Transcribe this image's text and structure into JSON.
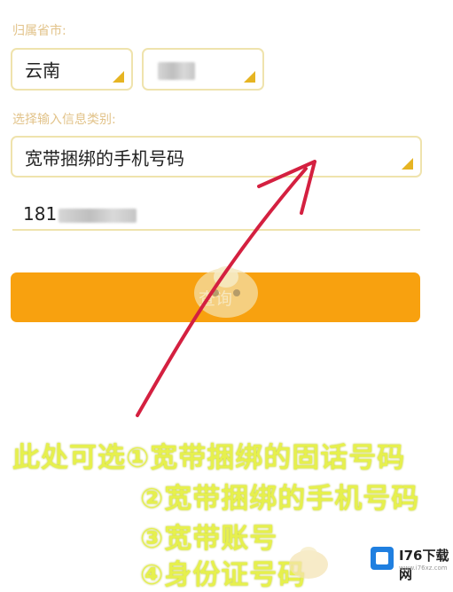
{
  "form": {
    "province_city_label": "归属省市:",
    "province_value": "云南",
    "info_type_label": "选择输入信息类别:",
    "info_type_value": "宽带捆绑的手机号码",
    "phone_visible_prefix": "181",
    "query_button_label": "查询"
  },
  "annotation": {
    "line1": "此处可选①宽带捆绑的固话号码",
    "line2": "②宽带捆绑的手机号码",
    "line3": "③宽带账号",
    "line4": "④身份证号码"
  },
  "watermark": {
    "site_name": "I76下载网",
    "site_url": "www.i76xz.com"
  },
  "colors": {
    "accent_orange": "#f8a10f",
    "border_yellow": "#efe3ad",
    "arrow_red": "#d42040",
    "callout_yellow": "#e6f04d"
  }
}
